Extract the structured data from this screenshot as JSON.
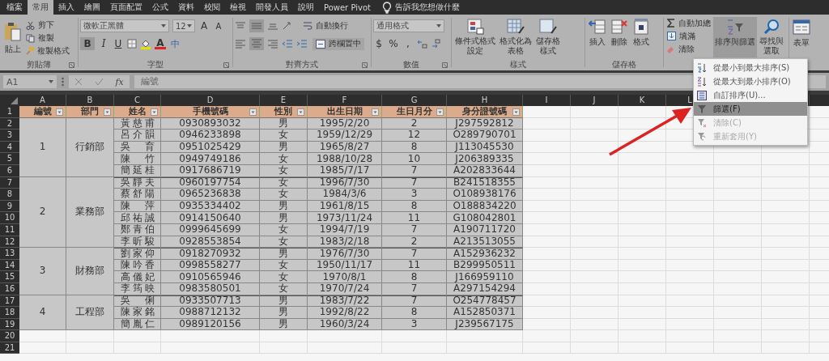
{
  "tabs": [
    {
      "label": "檔案",
      "selected": false
    },
    {
      "label": "常用",
      "selected": true
    },
    {
      "label": "插入",
      "selected": false
    },
    {
      "label": "繪圖",
      "selected": false
    },
    {
      "label": "頁面配置",
      "selected": false
    },
    {
      "label": "公式",
      "selected": false
    },
    {
      "label": "資料",
      "selected": false
    },
    {
      "label": "校閱",
      "selected": false
    },
    {
      "label": "檢視",
      "selected": false
    },
    {
      "label": "開發人員",
      "selected": false
    },
    {
      "label": "說明",
      "selected": false
    },
    {
      "label": "Power Pivot",
      "selected": false
    }
  ],
  "tell_me": "告訴我您想做什麼",
  "ribbon": {
    "clipboard": {
      "label": "剪貼簿",
      "paste": "貼上",
      "cut": "剪下",
      "copy": "複製",
      "format_painter": "複製格式"
    },
    "font": {
      "label": "字型",
      "font_name": "微軟正黑體",
      "font_size": "12",
      "grow": "A",
      "shrink": "A",
      "bold": "B",
      "italic": "I",
      "underline": "U",
      "font_color": "A",
      "phonetic": "中"
    },
    "alignment": {
      "label": "對齊方式",
      "wrap_text": "自動換行",
      "merge_center": "跨欄置中"
    },
    "number": {
      "label": "數值",
      "format": "通用格式",
      "currency": "$",
      "percent": "%",
      "comma": ","
    },
    "styles": {
      "label": "樣式",
      "buttons": [
        {
          "lines": [
            "條件式格式",
            "設定"
          ],
          "kind": "conditional"
        },
        {
          "lines": [
            "格式化為",
            "表格"
          ],
          "kind": "table"
        },
        {
          "lines": [
            "儲存格",
            "樣式"
          ],
          "kind": "cellstyle"
        }
      ]
    },
    "cells": {
      "label": "儲存格",
      "buttons": [
        {
          "label": "插入",
          "kind": "insert"
        },
        {
          "label": "刪除",
          "kind": "delete"
        },
        {
          "label": "格式",
          "kind": "format"
        }
      ]
    },
    "editing": {
      "autosum": "自動加總",
      "fill": "填滿",
      "clear": "清除",
      "sort_filter": "排序與篩選",
      "find_select": [
        "尋找與",
        "選取"
      ]
    },
    "forms": "表單"
  },
  "formula_bar": {
    "name_box": "A1",
    "fx": "fx",
    "value": "編號"
  },
  "sheet": {
    "columns": [
      "A",
      "B",
      "C",
      "D",
      "E",
      "F",
      "G",
      "H",
      "I",
      "J",
      "K",
      "L"
    ],
    "row_numbers": [
      "1",
      "2",
      "3",
      "4",
      "5",
      "6",
      "7",
      "8",
      "9",
      "10",
      "11",
      "12",
      "13",
      "14",
      "15",
      "16",
      "17",
      "18",
      "19",
      "20",
      "21"
    ],
    "header": [
      "編號",
      "部門",
      "姓名",
      "手機號碼",
      "性別",
      "出生日期",
      "生日月分",
      "身分證號碼"
    ],
    "groups": [
      {
        "number": "1",
        "dept": "行銷部",
        "rows": [
          {
            "name": "黃慈甫",
            "phone": "0930893032",
            "gender": "男",
            "birth": "1995/2/20",
            "month": "2",
            "id": "J297592812"
          },
          {
            "name": "呂介韻",
            "phone": "0946233898",
            "gender": "女",
            "birth": "1959/12/29",
            "month": "12",
            "id": "O289790701"
          },
          {
            "name": "吳育",
            "phone": "0951025429",
            "gender": "男",
            "birth": "1965/8/27",
            "month": "8",
            "id": "J113045530"
          },
          {
            "name": "陳竹",
            "phone": "0949749186",
            "gender": "女",
            "birth": "1988/10/28",
            "month": "10",
            "id": "J206389335"
          },
          {
            "name": "簡延桂",
            "phone": "0917686719",
            "gender": "女",
            "birth": "1985/7/17",
            "month": "7",
            "id": "A202833644"
          }
        ]
      },
      {
        "number": "2",
        "dept": "業務部",
        "rows": [
          {
            "name": "吳靜夫",
            "phone": "0960197754",
            "gender": "女",
            "birth": "1996/7/30",
            "month": "7",
            "id": "B241518355"
          },
          {
            "name": "蔡舒陽",
            "phone": "0965236838",
            "gender": "女",
            "birth": "1984/3/6",
            "month": "3",
            "id": "O108938176"
          },
          {
            "name": "陳萍",
            "phone": "0935334402",
            "gender": "男",
            "birth": "1961/8/15",
            "month": "8",
            "id": "O188834220"
          },
          {
            "name": "邱祐誠",
            "phone": "0914150640",
            "gender": "男",
            "birth": "1973/11/24",
            "month": "11",
            "id": "G108042801"
          },
          {
            "name": "鄭青伯",
            "phone": "0999645699",
            "gender": "女",
            "birth": "1994/7/19",
            "month": "7",
            "id": "A190711720"
          },
          {
            "name": "李昕駿",
            "phone": "0928553854",
            "gender": "女",
            "birth": "1983/2/18",
            "month": "2",
            "id": "A213513055"
          }
        ]
      },
      {
        "number": "3",
        "dept": "財務部",
        "rows": [
          {
            "name": "劉家仰",
            "phone": "0918270932",
            "gender": "男",
            "birth": "1976/7/30",
            "month": "7",
            "id": "A152936232"
          },
          {
            "name": "陳吟香",
            "phone": "0998558277",
            "gender": "女",
            "birth": "1950/11/17",
            "month": "11",
            "id": "B299950511"
          },
          {
            "name": "高儀妃",
            "phone": "0910565946",
            "gender": "女",
            "birth": "1970/8/1",
            "month": "8",
            "id": "J166959110"
          },
          {
            "name": "李筠映",
            "phone": "0983580501",
            "gender": "女",
            "birth": "1970/7/24",
            "month": "7",
            "id": "A297154294"
          }
        ]
      },
      {
        "number": "4",
        "dept": "工程部",
        "rows": [
          {
            "name": "吳俐",
            "phone": "0933507713",
            "gender": "男",
            "birth": "1983/7/22",
            "month": "7",
            "id": "O254778457"
          },
          {
            "name": "陳家銘",
            "phone": "0988712132",
            "gender": "男",
            "birth": "1992/8/22",
            "month": "8",
            "id": "A152850371"
          },
          {
            "name": "簡胤仁",
            "phone": "0989120156",
            "gender": "男",
            "birth": "1960/3/24",
            "month": "3",
            "id": "J239567175"
          }
        ]
      }
    ]
  },
  "sort_menu": [
    {
      "label": "從最小到最大排序(S)",
      "kind": "sort-asc",
      "selected": false,
      "disabled": false
    },
    {
      "label": "從最大到最小排序(O)",
      "kind": "sort-desc",
      "selected": false,
      "disabled": false
    },
    {
      "label": "自訂排序(U)...",
      "kind": "custom",
      "selected": false,
      "disabled": false
    },
    {
      "label": "篩選(F)",
      "kind": "filter",
      "selected": true,
      "disabled": false
    },
    {
      "label": "清除(C)",
      "kind": "clear",
      "selected": false,
      "disabled": true
    },
    {
      "label": "重新套用(Y)",
      "kind": "reapply",
      "selected": false,
      "disabled": true
    }
  ]
}
